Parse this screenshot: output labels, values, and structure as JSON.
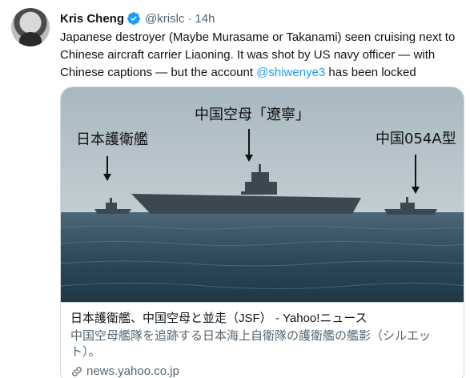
{
  "tweet": {
    "author_name": "Kris Cheng",
    "author_handle": "@krislc",
    "separator": "·",
    "time": "14h",
    "text_before_mention": "Japanese destroyer (Maybe Murasame or Takanami) seen cruising next to Chinese aircraft carrier Liaoning. It was shot by US navy officer — with Chinese captions — but the account ",
    "mention": "@shiwenye3",
    "text_after_mention": " has been locked"
  },
  "card": {
    "image_captions": {
      "left": "日本護衛艦",
      "center": "中国空母「遼寧」",
      "right": "中国054A型"
    },
    "title": "日本護衛艦、中国空母と並走（JSF） - Yahoo!ニュース",
    "description": "中国空母艦隊を追跡する日本海上自衛隊の護衛艦の艦影（シルエット）。",
    "domain": "news.yahoo.co.jp"
  },
  "colors": {
    "accent": "#1d9bf0",
    "muted": "#536471",
    "border": "#cfd9de"
  },
  "icons": [
    "verified-badge-icon",
    "link-icon"
  ]
}
